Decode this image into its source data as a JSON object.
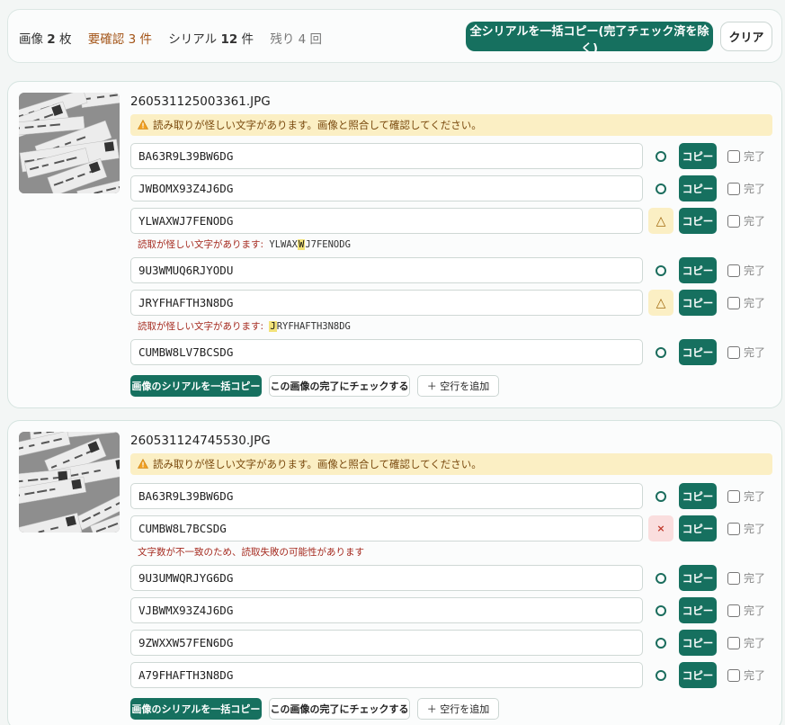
{
  "summary": {
    "images_label": "画像",
    "images_count": "2",
    "images_unit": "枚",
    "review_label": "要確認",
    "review_count": "3",
    "review_unit": "件",
    "serial_label": "シリアル",
    "serial_count": "12",
    "serial_unit": "件",
    "remaining_label": "残り",
    "remaining_count": "4",
    "remaining_unit": "回",
    "copy_all_label": "全シリアルを一括コピー(完了チェック済を除く)",
    "clear_label": "クリア"
  },
  "cards": [
    {
      "filename": "260531125003361.JPG",
      "warning": "読み取りが怪しい文字があります。画像と照合して確認してください。",
      "rows": [
        {
          "value": "BA63R9L39BW6DG",
          "status": "ok",
          "status_symbol": "",
          "copy_label": "コピー",
          "done_label": "完了"
        },
        {
          "value": "JWBOMX93Z4J6DG",
          "status": "ok",
          "status_symbol": "",
          "copy_label": "コピー",
          "done_label": "完了"
        },
        {
          "value": "YLWAXWJ7FENODG",
          "status": "warn",
          "status_symbol": "△",
          "copy_label": "コピー",
          "done_label": "完了",
          "note_label": "読取が怪しい文字があります:",
          "note_pre": "YLWAX",
          "note_hl": "W",
          "note_post": "J7FENODG"
        },
        {
          "value": "9U3WMUQ6RJYODU",
          "status": "ok",
          "status_symbol": "",
          "copy_label": "コピー",
          "done_label": "完了"
        },
        {
          "value": "JRYFHAFTH3N8DG",
          "status": "warn",
          "status_symbol": "△",
          "copy_label": "コピー",
          "done_label": "完了",
          "note_label": "読取が怪しい文字があります:",
          "note_pre": "",
          "note_hl": "J",
          "note_post": "RYFHAFTH3N8DG"
        },
        {
          "value": "CUMBW8LV7BCSDG",
          "status": "ok",
          "status_symbol": "",
          "copy_label": "コピー",
          "done_label": "完了"
        }
      ],
      "actions": {
        "copy_image": "画像のシリアルを一括コピー",
        "check_image": "この画像の完了にチェックする",
        "add_row": "＋ 空行を追加"
      }
    },
    {
      "filename": "260531124745530.JPG",
      "warning": "読み取りが怪しい文字があります。画像と照合して確認してください。",
      "rows": [
        {
          "value": "BA63R9L39BW6DG",
          "status": "ok",
          "status_symbol": "",
          "copy_label": "コピー",
          "done_label": "完了"
        },
        {
          "value": "CUMBW8L7BCSDG",
          "status": "err",
          "status_symbol": "×",
          "copy_label": "コピー",
          "done_label": "完了",
          "note_label": "文字数が不一致のため、読取失敗の可能性があります"
        },
        {
          "value": "9U3UMWQRJYG6DG",
          "status": "ok",
          "status_symbol": "",
          "copy_label": "コピー",
          "done_label": "完了"
        },
        {
          "value": "VJBWMX93Z4J6DG",
          "status": "ok",
          "status_symbol": "",
          "copy_label": "コピー",
          "done_label": "完了"
        },
        {
          "value": "9ZWXXW57FEN6DG",
          "status": "ok",
          "status_symbol": "",
          "copy_label": "コピー",
          "done_label": "完了"
        },
        {
          "value": "A79FHAFTH3N8DG",
          "status": "ok",
          "status_symbol": "",
          "copy_label": "コピー",
          "done_label": "完了"
        }
      ],
      "actions": {
        "copy_image": "画像のシリアルを一括コピー",
        "check_image": "この画像の完了にチェックする",
        "add_row": "＋ 空行を追加"
      }
    }
  ]
}
